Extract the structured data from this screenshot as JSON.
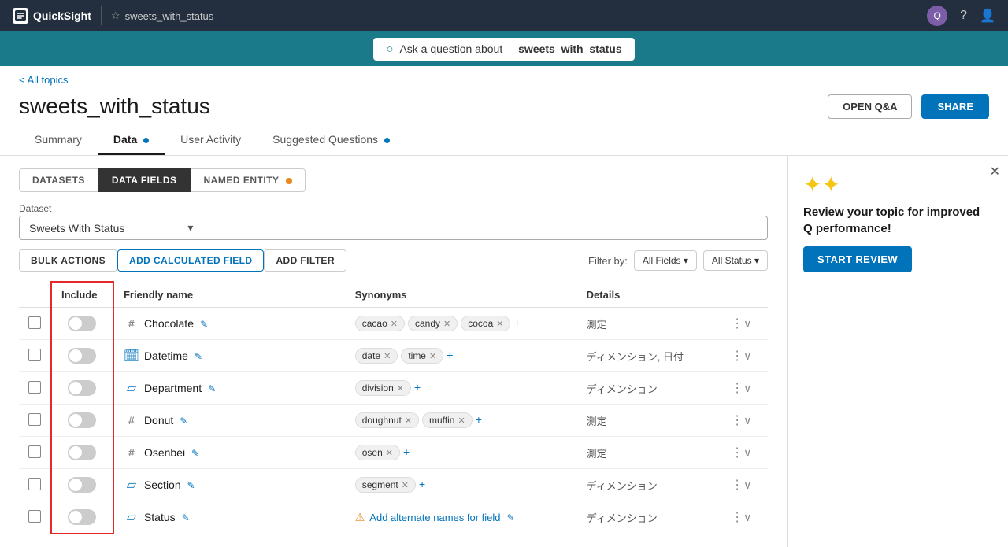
{
  "topNav": {
    "appName": "QuickSight",
    "pageTitle": "sweets_with_status",
    "userIcon": "user-icon",
    "helpIcon": "help-icon",
    "settingsIcon": "settings-icon"
  },
  "qBar": {
    "text": "Ask a question about",
    "dataset": "sweets_with_status"
  },
  "breadcrumb": "< All topics",
  "pageTitle": "sweets_with_status",
  "headerButtons": {
    "openQA": "OPEN Q&A",
    "share": "SHARE"
  },
  "tabs": [
    {
      "label": "Summary",
      "active": false,
      "dot": false
    },
    {
      "label": "Data",
      "active": true,
      "dot": true
    },
    {
      "label": "User Activity",
      "active": false,
      "dot": false
    },
    {
      "label": "Suggested Questions",
      "active": false,
      "dot": true
    }
  ],
  "subNav": {
    "datasets": "DATASETS",
    "dataFields": "DATA FIELDS",
    "namedEntity": "NAMED ENTITY"
  },
  "actions": {
    "bulkActions": "BULK ACTIONS",
    "addCalculatedField": "ADD CALCULATED FIELD",
    "addFilter": "ADD FILTER",
    "filterBy": "Filter by:"
  },
  "dataset": {
    "label": "Dataset",
    "value": "Sweets With Status",
    "options": [
      "Sweets With Status"
    ]
  },
  "table": {
    "headers": {
      "include": "Include",
      "friendlyName": "Friendly name",
      "synonyms": "Synonyms",
      "details": "Details"
    },
    "rows": [
      {
        "id": 1,
        "iconType": "hash",
        "fieldName": "Chocolate",
        "synonyms": [
          {
            "label": "cacao"
          },
          {
            "label": "candy"
          },
          {
            "label": "cocoa"
          }
        ],
        "detail": "測定",
        "toggleOn": false
      },
      {
        "id": 2,
        "iconType": "calendar",
        "fieldName": "Datetime",
        "synonyms": [
          {
            "label": "date"
          },
          {
            "label": "time"
          }
        ],
        "detail": "ディメンション, 日付",
        "toggleOn": false
      },
      {
        "id": 3,
        "iconType": "dimension",
        "fieldName": "Department",
        "synonyms": [
          {
            "label": "division"
          }
        ],
        "detail": "ディメンション",
        "toggleOn": false
      },
      {
        "id": 4,
        "iconType": "hash",
        "fieldName": "Donut",
        "synonyms": [
          {
            "label": "doughnut"
          },
          {
            "label": "muffin"
          }
        ],
        "detail": "測定",
        "toggleOn": false
      },
      {
        "id": 5,
        "iconType": "hash",
        "fieldName": "Osenbei",
        "synonyms": [
          {
            "label": "osen"
          }
        ],
        "detail": "測定",
        "toggleOn": false
      },
      {
        "id": 6,
        "iconType": "dimension",
        "fieldName": "Section",
        "synonyms": [
          {
            "label": "segment"
          }
        ],
        "detail": "ディメンション",
        "toggleOn": false
      },
      {
        "id": 7,
        "iconType": "dimension",
        "fieldName": "Status",
        "synonyms": [],
        "detail": "ディメンション",
        "toggleOn": false,
        "warning": true,
        "warningText": "Add alternate names for field"
      }
    ]
  },
  "reviewPanel": {
    "title": "Review your topic for improved Q performance!",
    "button": "START REVIEW"
  },
  "filterDropdowns": [
    "All Fields",
    "All Status"
  ],
  "colors": {
    "accent": "#0073bb",
    "warning": "#e8891d",
    "danger": "#e5282a",
    "toggleOff": "#ccc"
  }
}
